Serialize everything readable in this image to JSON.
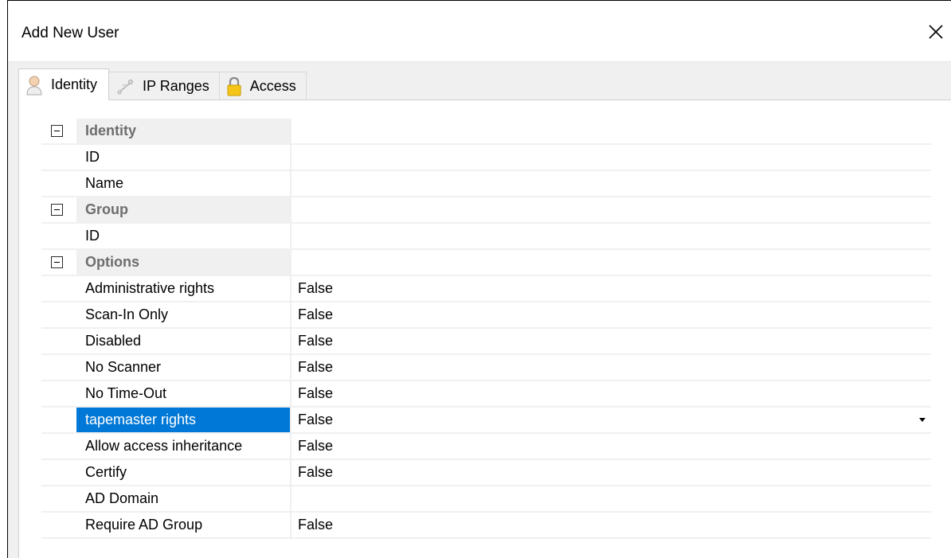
{
  "window": {
    "title": "Add New User"
  },
  "tabs": [
    {
      "label": "Identity",
      "icon": "user-icon",
      "active": true
    },
    {
      "label": "IP Ranges",
      "icon": "network-icon",
      "active": false
    },
    {
      "label": "Access",
      "icon": "lock-icon",
      "active": false
    }
  ],
  "grid": {
    "identity": {
      "category": "Identity",
      "id_label": "ID",
      "id_value": "",
      "name_label": "Name",
      "name_value": ""
    },
    "group": {
      "category": "Group",
      "id_label": "ID",
      "id_value": ""
    },
    "options": {
      "category": "Options",
      "rows": [
        {
          "label": "Administrative rights",
          "value": "False"
        },
        {
          "label": "Scan-In Only",
          "value": "False"
        },
        {
          "label": "Disabled",
          "value": "False"
        },
        {
          "label": "No Scanner",
          "value": "False"
        },
        {
          "label": "No Time-Out",
          "value": "False"
        },
        {
          "label": "tapemaster rights",
          "value": "False",
          "selected": true
        },
        {
          "label": "Allow access inheritance",
          "value": "False"
        },
        {
          "label": "Certify",
          "value": "False"
        },
        {
          "label": "AD Domain",
          "value": ""
        },
        {
          "label": "Require AD Group",
          "value": "False"
        }
      ]
    }
  },
  "colors": {
    "selection": "#0078d7",
    "category_bg": "#f0f0f0",
    "category_text": "#6d6d6d"
  }
}
